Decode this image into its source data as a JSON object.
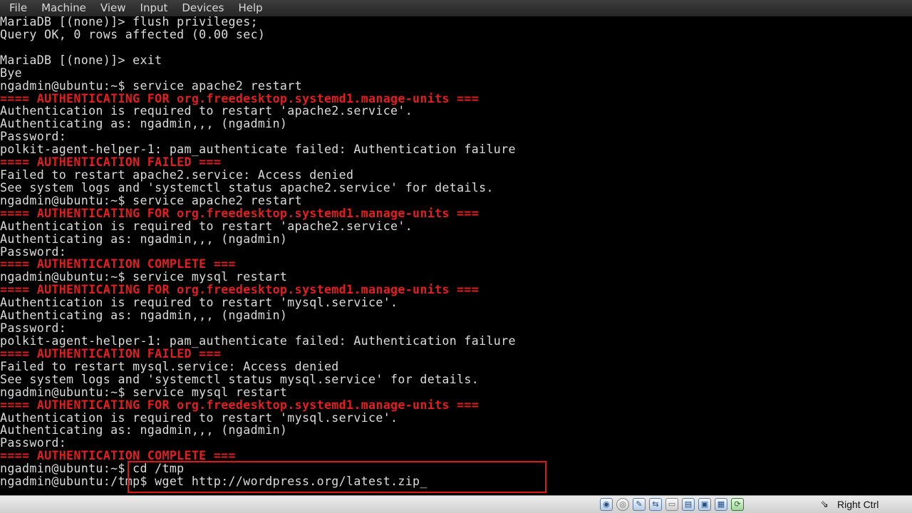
{
  "menubar": {
    "items": [
      "File",
      "Machine",
      "View",
      "Input",
      "Devices",
      "Help"
    ]
  },
  "terminal": {
    "lines": [
      {
        "text": "MariaDB [(none)]> flush privileges;",
        "color": "white"
      },
      {
        "text": "Query OK, 0 rows affected (0.00 sec)",
        "color": "white"
      },
      {
        "text": "",
        "color": "white"
      },
      {
        "text": "MariaDB [(none)]> exit",
        "color": "white"
      },
      {
        "text": "Bye",
        "color": "white"
      },
      {
        "text": "ngadmin@ubuntu:~$ service apache2 restart",
        "color": "white"
      },
      {
        "text": "==== AUTHENTICATING FOR org.freedesktop.systemd1.manage-units ===",
        "color": "red"
      },
      {
        "text": "Authentication is required to restart 'apache2.service'.",
        "color": "white"
      },
      {
        "text": "Authenticating as: ngadmin,,, (ngadmin)",
        "color": "white"
      },
      {
        "text": "Password:",
        "color": "white"
      },
      {
        "text": "polkit-agent-helper-1: pam_authenticate failed: Authentication failure",
        "color": "white"
      },
      {
        "text": "==== AUTHENTICATION FAILED ===",
        "color": "red"
      },
      {
        "text": "Failed to restart apache2.service: Access denied",
        "color": "white"
      },
      {
        "text": "See system logs and 'systemctl status apache2.service' for details.",
        "color": "white"
      },
      {
        "text": "ngadmin@ubuntu:~$ service apache2 restart",
        "color": "white"
      },
      {
        "text": "==== AUTHENTICATING FOR org.freedesktop.systemd1.manage-units ===",
        "color": "red"
      },
      {
        "text": "Authentication is required to restart 'apache2.service'.",
        "color": "white"
      },
      {
        "text": "Authenticating as: ngadmin,,, (ngadmin)",
        "color": "white"
      },
      {
        "text": "Password:",
        "color": "white"
      },
      {
        "text": "==== AUTHENTICATION COMPLETE ===",
        "color": "red"
      },
      {
        "text": "ngadmin@ubuntu:~$ service mysql restart",
        "color": "white"
      },
      {
        "text": "==== AUTHENTICATING FOR org.freedesktop.systemd1.manage-units ===",
        "color": "red"
      },
      {
        "text": "Authentication is required to restart 'mysql.service'.",
        "color": "white"
      },
      {
        "text": "Authenticating as: ngadmin,,, (ngadmin)",
        "color": "white"
      },
      {
        "text": "Password:",
        "color": "white"
      },
      {
        "text": "polkit-agent-helper-1: pam_authenticate failed: Authentication failure",
        "color": "white"
      },
      {
        "text": "==== AUTHENTICATION FAILED ===",
        "color": "red"
      },
      {
        "text": "Failed to restart mysql.service: Access denied",
        "color": "white"
      },
      {
        "text": "See system logs and 'systemctl status mysql.service' for details.",
        "color": "white"
      },
      {
        "text": "ngadmin@ubuntu:~$ service mysql restart",
        "color": "white"
      },
      {
        "text": "==== AUTHENTICATING FOR org.freedesktop.systemd1.manage-units ===",
        "color": "red"
      },
      {
        "text": "Authentication is required to restart 'mysql.service'.",
        "color": "white"
      },
      {
        "text": "Authenticating as: ngadmin,,, (ngadmin)",
        "color": "white"
      },
      {
        "text": "Password:",
        "color": "white"
      },
      {
        "text": "==== AUTHENTICATION COMPLETE ===",
        "color": "red"
      },
      {
        "text": "ngadmin@ubuntu:~$ cd /tmp",
        "color": "white"
      },
      {
        "text": "ngadmin@ubuntu:/tmp$ wget http://wordpress.org/latest.zip",
        "color": "white"
      }
    ],
    "cursor": "_"
  },
  "colors": {
    "terminal_bg": "#000000",
    "terminal_fg": "#dcdcdc",
    "terminal_red": "#e41e1e",
    "highlight_border": "#e01616"
  },
  "statusbar": {
    "icons": [
      "optical-drive-icon",
      "floppy-icon",
      "network-icon",
      "usb-icon",
      "shared-folder-icon",
      "display-icon",
      "video-capture-icon",
      "cpu-icon",
      "mouse-integration-icon",
      "host-key-arrow-icon"
    ],
    "host_key_label": "Right Ctrl"
  }
}
